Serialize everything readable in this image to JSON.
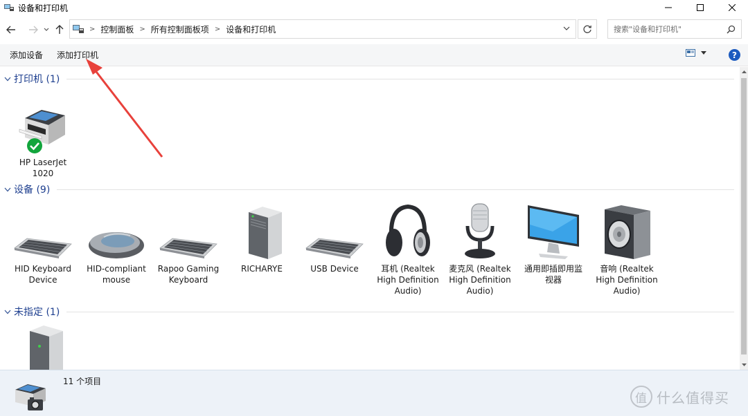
{
  "window": {
    "title": "设备和打印机",
    "minimize_glyph": "—",
    "maximize_glyph": "☐",
    "close_glyph": "✕"
  },
  "nav": {
    "back_glyph": "←",
    "forward_glyph": "→",
    "recent_glyph": "˅",
    "up_glyph": "↑"
  },
  "address": {
    "breadcrumb": [
      "控制面板",
      "所有控制面板项",
      "设备和打印机"
    ],
    "separator": ">"
  },
  "search": {
    "placeholder": "搜索\"设备和打印机\""
  },
  "commands": {
    "add_device": "添加设备",
    "add_printer": "添加打印机",
    "help": "?"
  },
  "groups": {
    "printers": {
      "title": "打印机 (1)",
      "items": [
        {
          "label_line1": "HP LaserJet",
          "label_line2": "1020",
          "icon": "printer-icon",
          "status": "default-check"
        }
      ]
    },
    "devices": {
      "title": "设备 (9)",
      "items": [
        {
          "label_line1": "HID Keyboard",
          "label_line2": "Device",
          "label_line3": "",
          "icon": "keyboard-icon"
        },
        {
          "label_line1": "HID-compliant",
          "label_line2": "mouse",
          "label_line3": "",
          "icon": "mouse-icon"
        },
        {
          "label_line1": "Rapoo Gaming",
          "label_line2": "Keyboard",
          "label_line3": "",
          "icon": "keyboard-icon"
        },
        {
          "label_line1": "RICHARYE",
          "label_line2": "",
          "label_line3": "",
          "icon": "computer-tower-icon"
        },
        {
          "label_line1": "USB Device",
          "label_line2": "",
          "label_line3": "",
          "icon": "keyboard-icon"
        },
        {
          "label_line1": "耳机 (Realtek",
          "label_line2": "High Definition",
          "label_line3": "Audio)",
          "icon": "headphones-icon"
        },
        {
          "label_line1": "麦克风 (Realtek",
          "label_line2": "High Definition",
          "label_line3": "Audio)",
          "icon": "microphone-icon"
        },
        {
          "label_line1": "通用即插即用监",
          "label_line2": "视器",
          "label_line3": "",
          "icon": "monitor-icon"
        },
        {
          "label_line1": "音响 (Realtek",
          "label_line2": "High Definition",
          "label_line3": "Audio)",
          "icon": "speaker-icon"
        }
      ]
    },
    "unspecified": {
      "title": "未指定 (1)",
      "items": [
        {
          "icon": "computer-tower-icon"
        }
      ]
    }
  },
  "status": {
    "count": "11 个项目"
  },
  "watermark": {
    "logo": "值",
    "text": "什么值得买"
  },
  "colors": {
    "group_title": "#1e3f8f",
    "annotation_arrow": "#e8413b",
    "details_bg": "#edf2f8",
    "help_bg": "#1c5bbf",
    "check_green": "#12a53c"
  }
}
